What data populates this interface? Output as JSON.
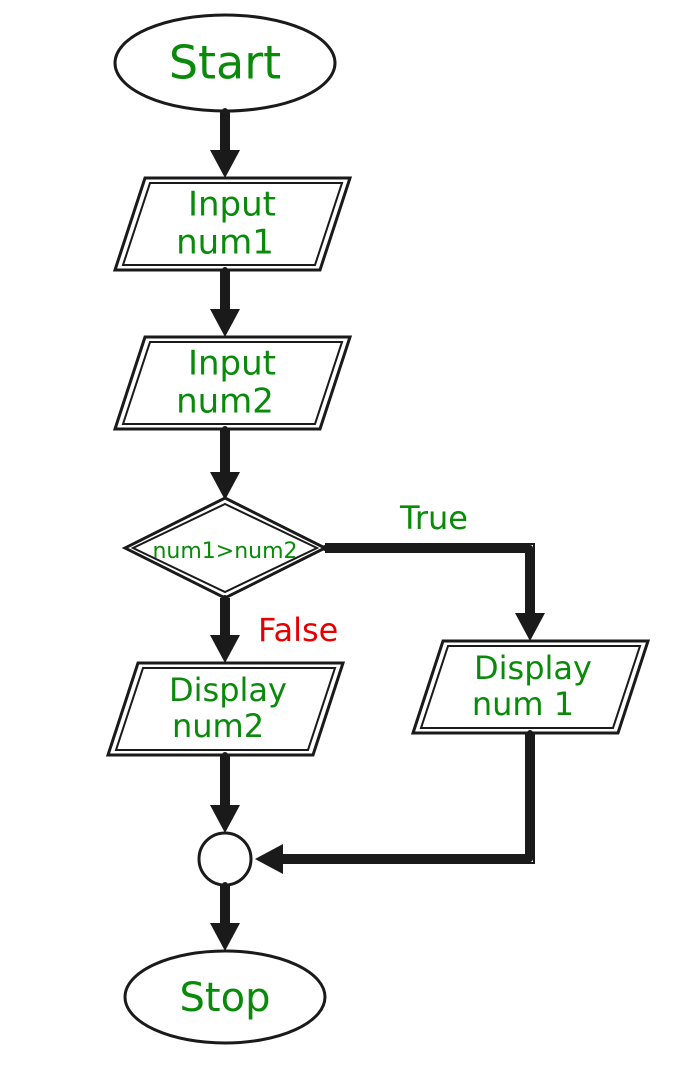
{
  "nodes": {
    "start": "Start",
    "input1_l1": "Input",
    "input1_l2": "num1",
    "input2_l1": "Input",
    "input2_l2": "num2",
    "decision": "num1>num2",
    "display_false_l1": "Display",
    "display_false_l2": "num2",
    "display_true_l1": "Display",
    "display_true_l2": "num 1",
    "stop": "Stop"
  },
  "edges": {
    "true": "True",
    "false": "False"
  },
  "colors": {
    "text": "#0a8a0a",
    "false": "#e60000",
    "stroke": "#1a1a1a"
  }
}
